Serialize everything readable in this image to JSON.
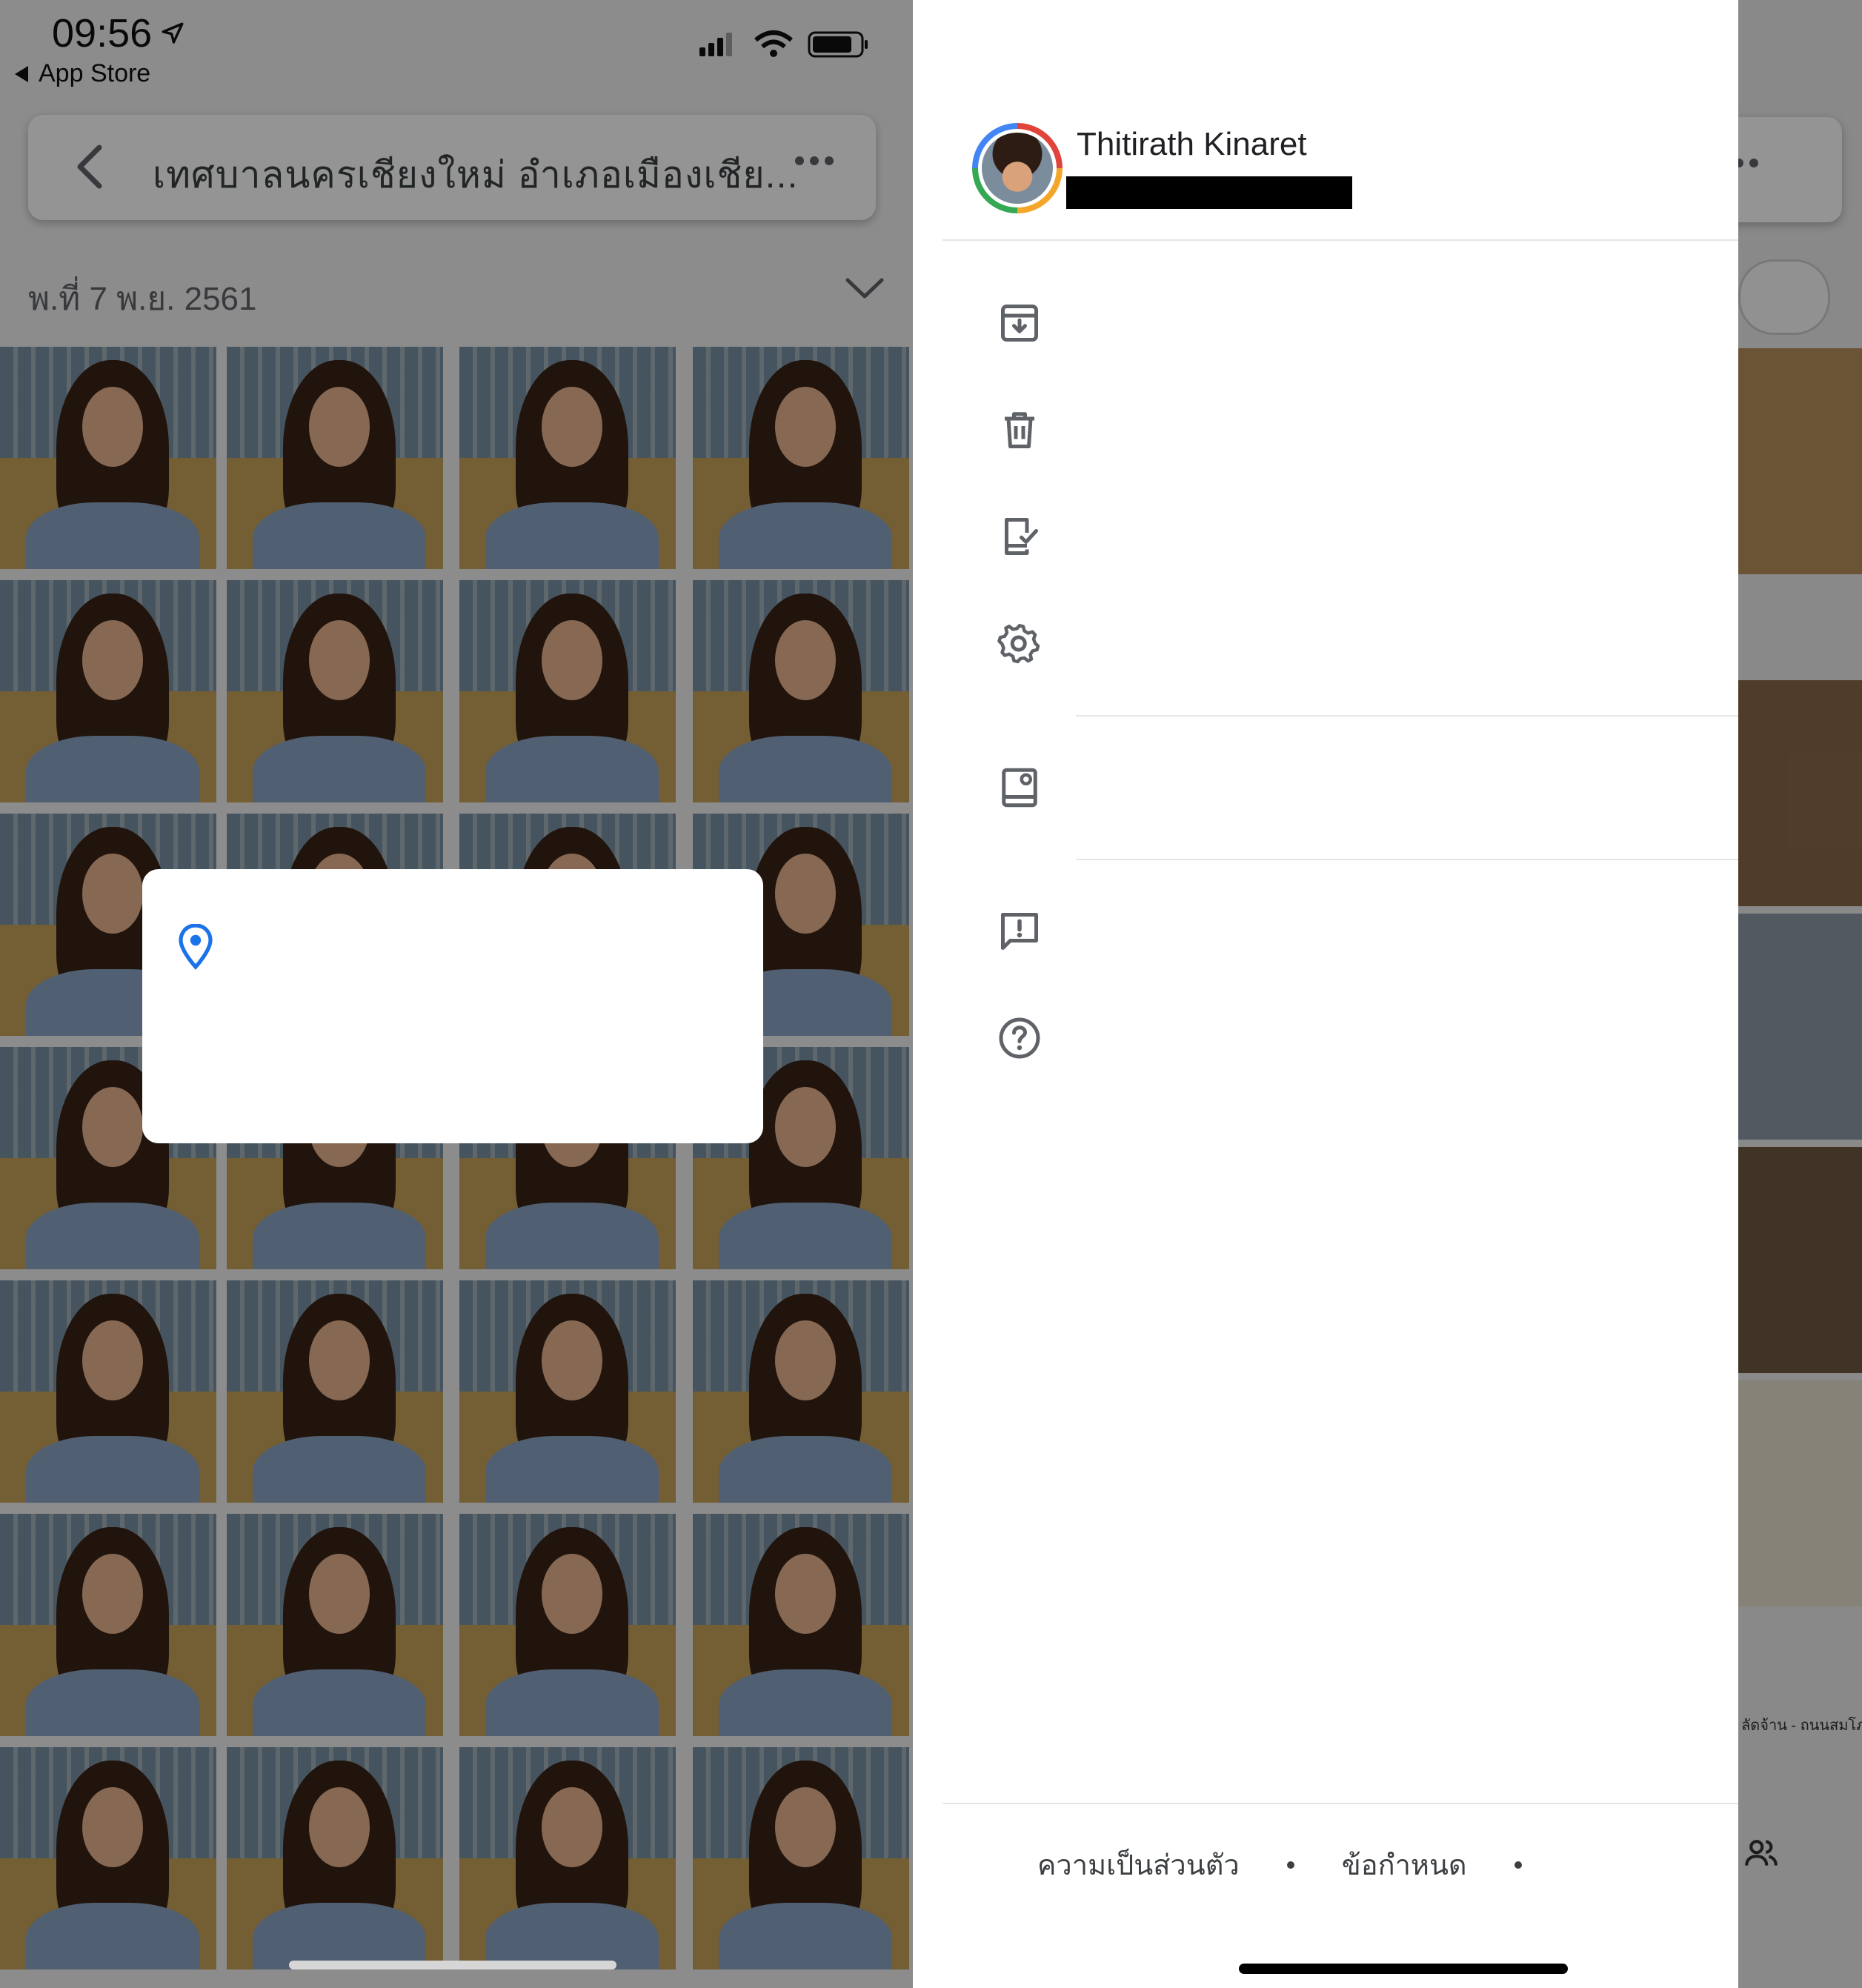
{
  "status_bar": {
    "time": "09:56",
    "back_label": "App Store",
    "icons": [
      "location-arrow-icon",
      "signal-icon",
      "wifi-icon",
      "battery-icon"
    ]
  },
  "search_bar": {
    "title": "เทศบาลนครเชียงใหม่ อำเภอเมืองเชีย..."
  },
  "date_header": "พ.ที่ 7 พ.ย. 2561",
  "account": {
    "name": "Thitirath Kinaret"
  },
  "menu": {
    "items": [
      {
        "icon": "archive-icon",
        "label": ""
      },
      {
        "icon": "trash-icon",
        "label": ""
      },
      {
        "icon": "device-check-icon",
        "label": ""
      },
      {
        "icon": "gear-icon",
        "label": ""
      },
      {
        "icon": "photo-frame-icon",
        "label": ""
      },
      {
        "icon": "feedback-icon",
        "label": ""
      },
      {
        "icon": "help-icon",
        "label": ""
      }
    ]
  },
  "footer": {
    "privacy": "ความเป็นส่วนตัว",
    "terms": "ข้อกำหนด"
  },
  "peek": {
    "caption": "ลัดจ้าน - ถนนสมโภช"
  },
  "colors": {
    "accent_blue": "#1a73e8",
    "icon_gray": "#5f6368",
    "text_dark": "#202124"
  }
}
